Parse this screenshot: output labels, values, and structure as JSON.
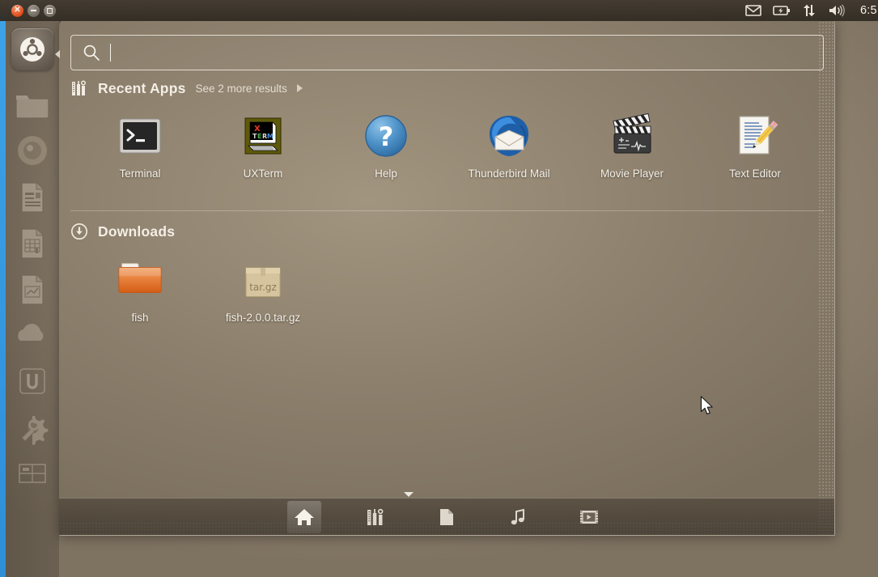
{
  "panel": {
    "window_controls": [
      {
        "name": "close",
        "glyph": "✕",
        "color": "#dd4814"
      },
      {
        "name": "minimize",
        "glyph": "–",
        "color": "#6e6861"
      },
      {
        "name": "maximize",
        "glyph": "□",
        "color": "#6e6861"
      }
    ],
    "indicators": [
      {
        "name": "messaging-icon",
        "label": "Messaging"
      },
      {
        "name": "battery-icon",
        "label": "Battery"
      },
      {
        "name": "network-icon",
        "label": "Network"
      },
      {
        "name": "volume-icon",
        "label": "Volume"
      }
    ],
    "clock": "6:5"
  },
  "launcher": {
    "bfb_label": "Ubuntu",
    "items": [
      {
        "name": "launcher-item-files",
        "label": "Files"
      },
      {
        "name": "launcher-item-firefox",
        "label": "Firefox Web Browser"
      },
      {
        "name": "launcher-item-writer",
        "label": "LibreOffice Writer"
      },
      {
        "name": "launcher-item-calc",
        "label": "LibreOffice Calc"
      },
      {
        "name": "launcher-item-impress",
        "label": "LibreOffice Impress"
      },
      {
        "name": "launcher-item-ubuntu-one",
        "label": "Ubuntu One"
      },
      {
        "name": "launcher-item-software-center",
        "label": "Ubuntu Software Center"
      },
      {
        "name": "launcher-item-system-settings",
        "label": "System Settings"
      },
      {
        "name": "launcher-item-workspace-switcher",
        "label": "Workspace Switcher"
      }
    ]
  },
  "dash": {
    "search": {
      "value": "",
      "placeholder": ""
    },
    "sections": [
      {
        "id": "recent-apps",
        "title": "Recent Apps",
        "more_label": "See 2 more results",
        "items": [
          {
            "label": "Terminal",
            "icon": "terminal-icon"
          },
          {
            "label": "UXTerm",
            "icon": "uxterm-icon"
          },
          {
            "label": "Help",
            "icon": "help-icon"
          },
          {
            "label": "Thunderbird Mail",
            "icon": "thunderbird-icon"
          },
          {
            "label": "Movie Player",
            "icon": "movie-player-icon"
          },
          {
            "label": "Text Editor",
            "icon": "text-editor-icon"
          }
        ]
      },
      {
        "id": "downloads",
        "title": "Downloads",
        "more_label": "",
        "items": [
          {
            "label": "fish",
            "icon": "folder-icon"
          },
          {
            "label": "fish-2.0.0.tar.gz",
            "icon": "archive-icon"
          }
        ]
      }
    ],
    "lenses": [
      {
        "name": "lens-home",
        "label": "Home",
        "active": true
      },
      {
        "name": "lens-applications",
        "label": "Applications",
        "active": false
      },
      {
        "name": "lens-files",
        "label": "Files & Folders",
        "active": false
      },
      {
        "name": "lens-music",
        "label": "Music",
        "active": false
      },
      {
        "name": "lens-video",
        "label": "Videos",
        "active": false
      }
    ]
  }
}
